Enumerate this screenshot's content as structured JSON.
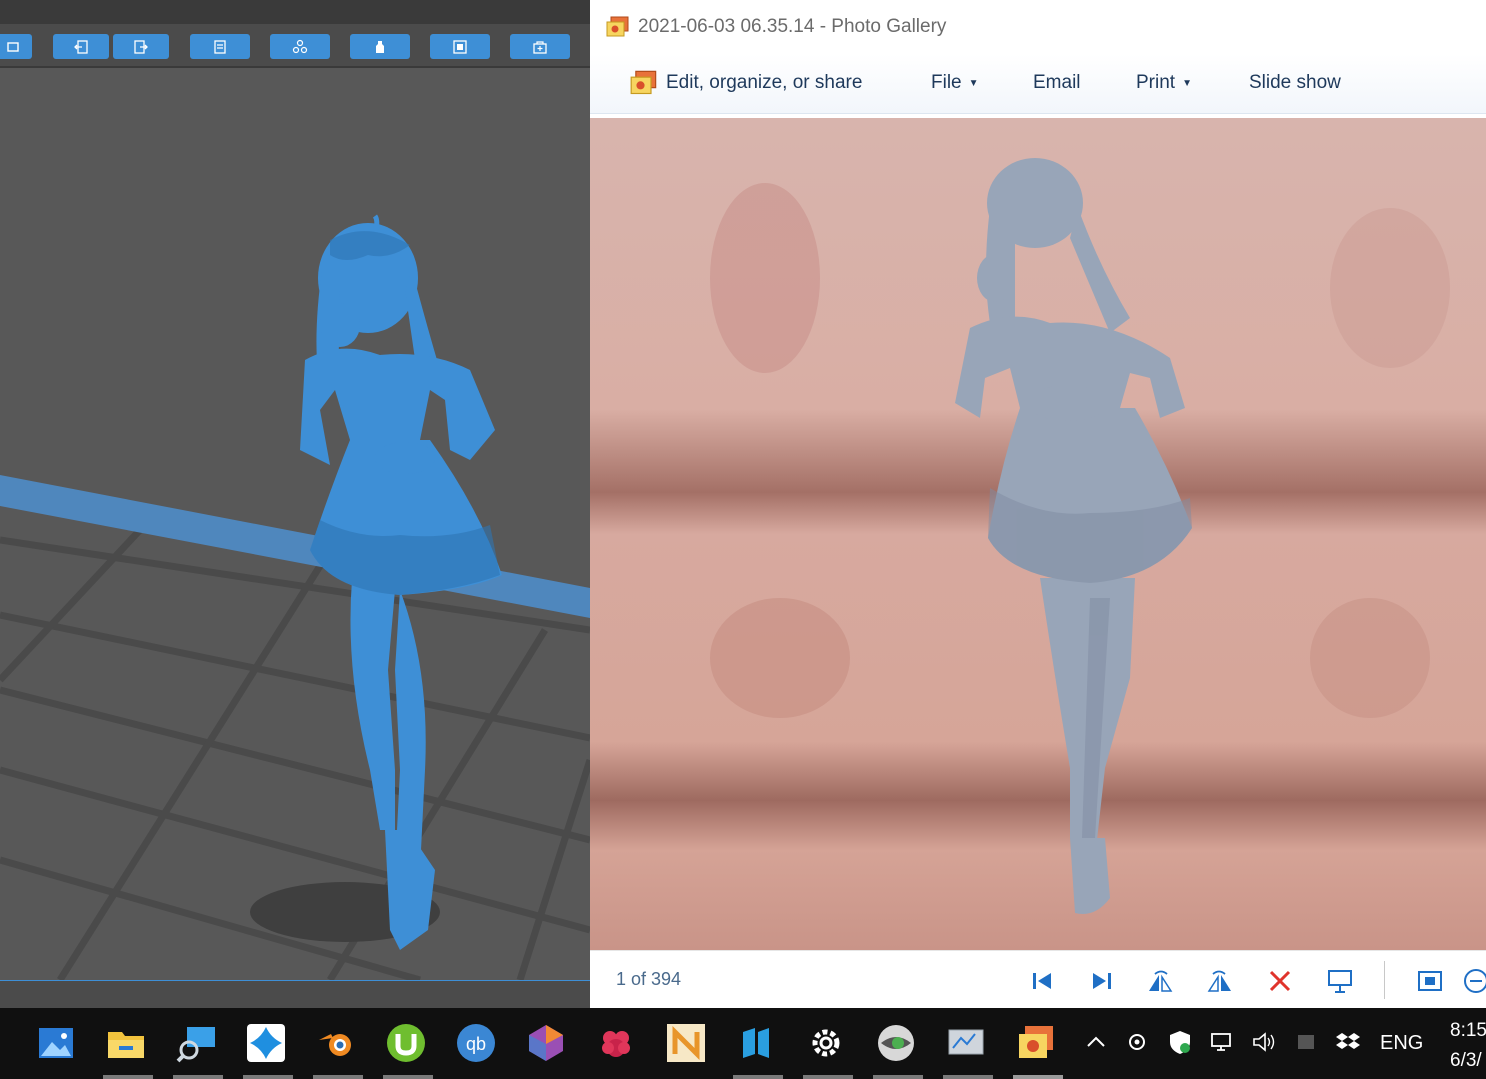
{
  "gallery": {
    "title": "2021-06-03 06.35.14 - Photo Gallery",
    "menu": {
      "edit": "Edit, organize, or share",
      "file": "File",
      "email": "Email",
      "print": "Print",
      "slideshow": "Slide show"
    },
    "counter": "1 of 394"
  },
  "taskbar": {
    "apps": [
      "photos-icon",
      "file-explorer-icon",
      "remote-desktop-icon",
      "app-blue-diamond-icon",
      "blender-icon",
      "utorrent-icon",
      "qbittorrent-icon",
      "meshmixer-icon",
      "raspberry-icon",
      "nfp-icon",
      "slicer-n-icon",
      "settings-icon",
      "eye-app-icon",
      "monitor-app-icon",
      "photo-gallery-icon"
    ],
    "language": "ENG",
    "time": "8:15",
    "date": "6/3/"
  },
  "colors": {
    "accent": "#3e8fd6",
    "model": "#3e8fd6",
    "viewport": "#585858",
    "printed_figure": "#98a5b8"
  }
}
